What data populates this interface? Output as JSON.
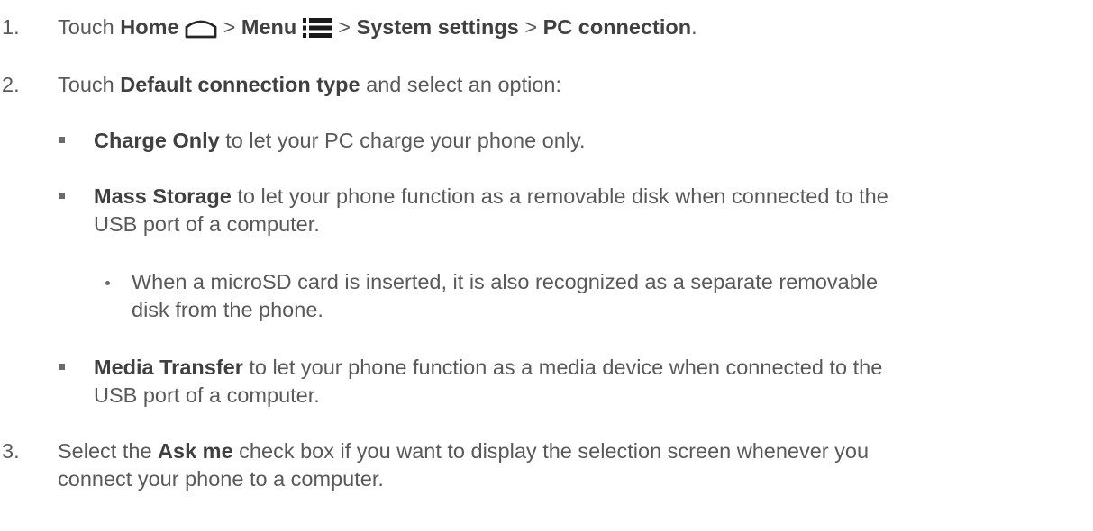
{
  "steps": [
    {
      "num": "1.",
      "pre": "Touch ",
      "home": "Home",
      "sep1": " > ",
      "menu": "Menu",
      "sep2": " > ",
      "system_settings": "System settings",
      "sep3": " > ",
      "pc_connection": "PC connection",
      "end": "."
    },
    {
      "num": "2.",
      "pre": "Touch ",
      "bold": "Default connection type",
      "post": " and select an option:"
    },
    {
      "num": "3.",
      "pre": "Select the ",
      "bold": "Ask me",
      "post_line1": " check box if you want to display the selection screen whenever you",
      "line2": "connect your phone to a computer."
    }
  ],
  "options": [
    {
      "bold": "Charge Only",
      "rest": " to let your PC charge your phone only."
    },
    {
      "bold": "Mass Storage",
      "rest_line1": " to let your phone function as a removable disk when connected to the",
      "line2": "USB port of a computer."
    },
    {
      "bold": "Media Transfer",
      "rest_line1": " to let your phone function as a media device when connected to the",
      "line2": "USB port of a computer."
    }
  ],
  "note": {
    "line1": "When a microSD card is inserted, it is also recognized as a separate removable",
    "line2": "disk from the phone."
  },
  "icons": {
    "home": "home-outline-icon",
    "menu": "menu-list-icon"
  }
}
